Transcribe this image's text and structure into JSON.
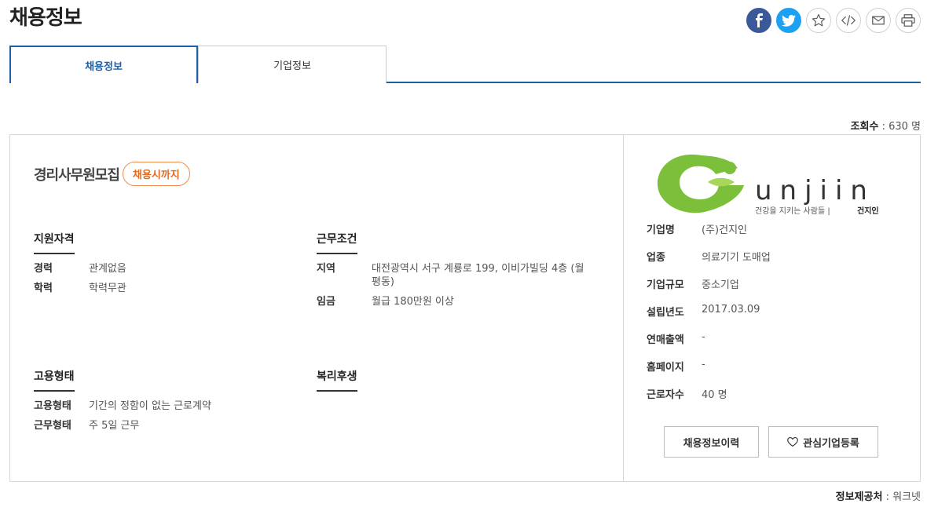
{
  "page": {
    "title": "채용정보"
  },
  "share": {
    "buttons": [
      {
        "icon": "facebook-icon"
      },
      {
        "icon": "twitter-icon"
      },
      {
        "icon": "star-icon"
      },
      {
        "icon": "code-icon"
      },
      {
        "icon": "mail-icon"
      },
      {
        "icon": "print-icon"
      }
    ],
    "colors": {
      "facebook": "#3b5998",
      "twitter": "#1da1f2"
    }
  },
  "tabs": [
    {
      "label": "채용정보",
      "active": true
    },
    {
      "label": "기업정보",
      "active": false
    }
  ],
  "views": {
    "label": "조회수",
    "value": "630 명"
  },
  "job": {
    "title": "경리사무원모집",
    "badge": "채용시까지",
    "qualifications": {
      "heading": "지원자격",
      "rows": [
        {
          "k": "경력",
          "v": "관계없음"
        },
        {
          "k": "학력",
          "v": "학력무관"
        }
      ]
    },
    "conditions": {
      "heading": "근무조건",
      "rows": [
        {
          "k": "지역",
          "v": "대전광역시 서구 계룡로 199, 이비가빌딩 4층 (월평동)"
        },
        {
          "k": "임금",
          "v": "월급 180만원 이상"
        }
      ]
    },
    "employment": {
      "heading": "고용형태",
      "rows": [
        {
          "k": "고용형태",
          "v": "기간의 정함이 없는 근로계약"
        },
        {
          "k": "근무형태",
          "v": "주 5일 근무"
        }
      ]
    },
    "welfare": {
      "heading": "복리후생"
    }
  },
  "company": {
    "logo": {
      "wordmark": "unjiin",
      "tagline_prefix": "건강을 지키는 사람들 |",
      "tagline_brand": "건지인"
    },
    "rows": [
      {
        "k": "기업명",
        "v": "(주)건지인"
      },
      {
        "k": "업종",
        "v": "의료기기 도매업"
      },
      {
        "k": "기업규모",
        "v": "중소기업"
      },
      {
        "k": "설립년도",
        "v": "2017.03.09"
      },
      {
        "k": "연매출액",
        "v": "-"
      },
      {
        "k": "홈페이지",
        "v": "-"
      },
      {
        "k": "근로자수",
        "v": "40 명"
      }
    ],
    "history_button": "채용정보이력",
    "favorite_button": "관심기업등록"
  },
  "source": {
    "label": "정보제공처",
    "value": "워크넷"
  }
}
